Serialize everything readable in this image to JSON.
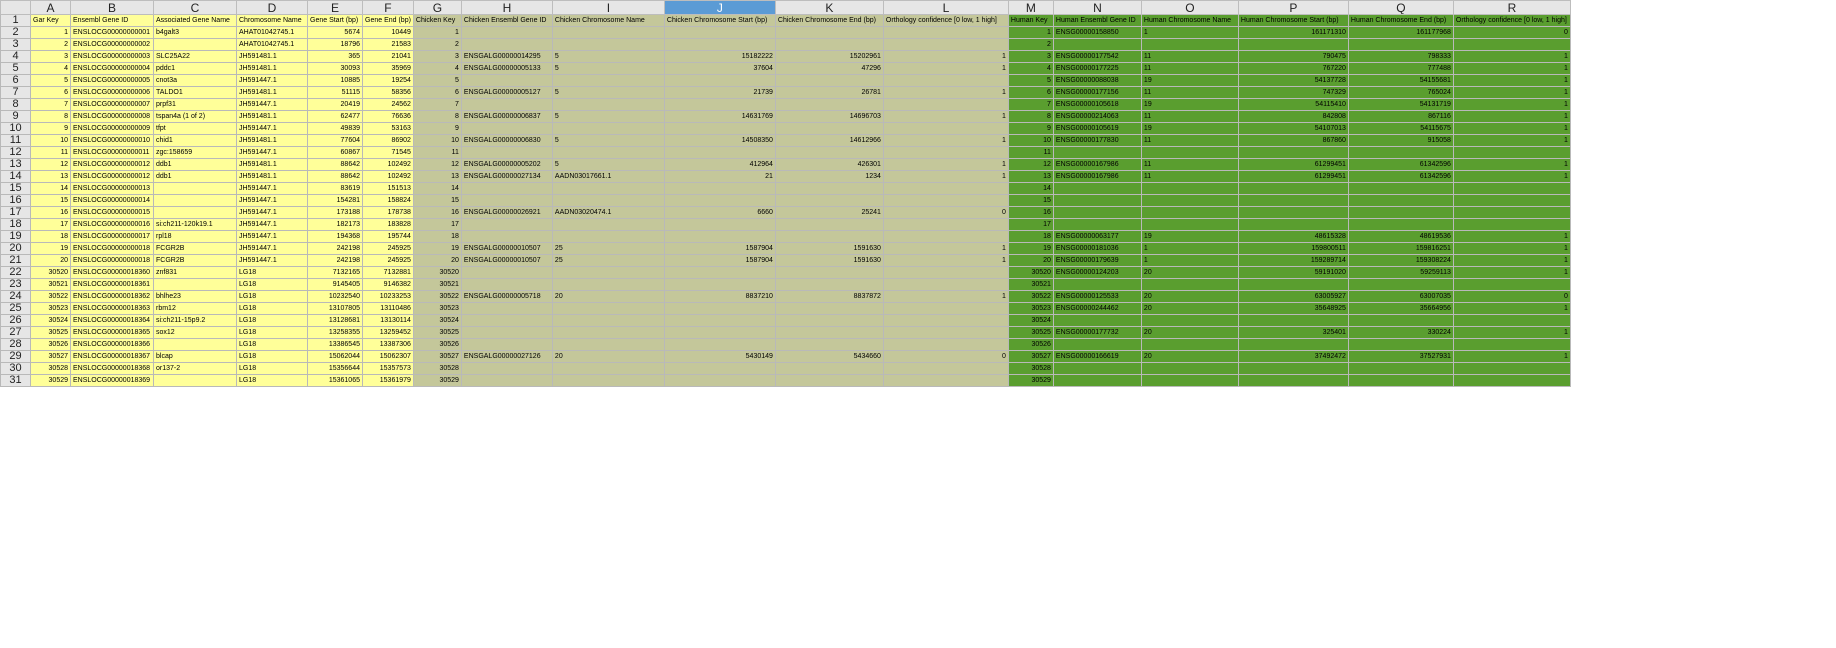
{
  "columns": [
    "A",
    "B",
    "C",
    "D",
    "E",
    "F",
    "G",
    "H",
    "I",
    "J",
    "K",
    "L",
    "M",
    "N",
    "O",
    "P",
    "Q",
    "R"
  ],
  "selected_column": "J",
  "colors": {
    "fish": "#ffff99",
    "chicken": "#c4c79a",
    "human": "#5a9e2f",
    "selection": "#5b9bd5"
  },
  "rows": [
    [
      "Gar Key",
      "Ensembl Gene ID",
      "Associated Gene Name",
      "Chromosome Name",
      "Gene Start (bp)",
      "Gene End (bp)",
      "Chicken Key",
      "Chicken Ensembl Gene ID",
      "Chicken Chromosome Name",
      "Chicken Chromosome Start (bp)",
      "Chicken Chromosome End (bp)",
      "Orthology confidence [0 low, 1 high]",
      "Human Key",
      "Human Ensembl Gene ID",
      "Human Chromosome Name",
      "Human Chromosome Start (bp)",
      "Human Chromosome End (bp)",
      "Orthology confidence [0 low, 1 high]"
    ],
    [
      "1",
      "ENSLOCG00000000001",
      "b4galt3",
      "AHAT01042745.1",
      "5674",
      "10449",
      "1",
      "",
      "",
      "",
      "",
      "",
      "1",
      "ENSG00000158850",
      "1",
      "161171310",
      "161177968",
      "0"
    ],
    [
      "2",
      "ENSLOCG00000000002",
      "",
      "AHAT01042745.1",
      "18796",
      "21583",
      "2",
      "",
      "",
      "",
      "",
      "",
      "2",
      "",
      "",
      "",
      "",
      ""
    ],
    [
      "3",
      "ENSLOCG00000000003",
      "SLC25A22",
      "JH591481.1",
      "365",
      "21041",
      "3",
      "ENSGALG00000014295",
      "5",
      "15182222",
      "15202961",
      "1",
      "3",
      "ENSG00000177542",
      "11",
      "790475",
      "798333",
      "1"
    ],
    [
      "4",
      "ENSLOCG00000000004",
      "pddc1",
      "JH591481.1",
      "30093",
      "35969",
      "4",
      "ENSGALG00000005133",
      "5",
      "37604",
      "47296",
      "1",
      "4",
      "ENSG00000177225",
      "11",
      "767220",
      "777488",
      "1"
    ],
    [
      "5",
      "ENSLOCG00000000005",
      "cnot3a",
      "JH591447.1",
      "10885",
      "19254",
      "5",
      "",
      "",
      "",
      "",
      "",
      "5",
      "ENSG00000088038",
      "19",
      "54137728",
      "54155681",
      "1"
    ],
    [
      "6",
      "ENSLOCG00000000006",
      "TALDO1",
      "JH591481.1",
      "51115",
      "58356",
      "6",
      "ENSGALG00000005127",
      "5",
      "21739",
      "26781",
      "1",
      "6",
      "ENSG00000177156",
      "11",
      "747329",
      "765024",
      "1"
    ],
    [
      "7",
      "ENSLOCG00000000007",
      "prpf31",
      "JH591447.1",
      "20419",
      "24562",
      "7",
      "",
      "",
      "",
      "",
      "",
      "7",
      "ENSG00000105618",
      "19",
      "54115410",
      "54131719",
      "1"
    ],
    [
      "8",
      "ENSLOCG00000000008",
      "tspan4a (1 of 2)",
      "JH591481.1",
      "62477",
      "76636",
      "8",
      "ENSGALG00000006837",
      "5",
      "14631769",
      "14696703",
      "1",
      "8",
      "ENSG00000214063",
      "11",
      "842808",
      "867116",
      "1"
    ],
    [
      "9",
      "ENSLOCG00000000009",
      "tfpt",
      "JH591447.1",
      "49839",
      "53163",
      "9",
      "",
      "",
      "",
      "",
      "",
      "9",
      "ENSG00000105619",
      "19",
      "54107013",
      "54115675",
      "1"
    ],
    [
      "10",
      "ENSLOCG00000000010",
      "chid1",
      "JH591481.1",
      "77604",
      "86902",
      "10",
      "ENSGALG00000006830",
      "5",
      "14508350",
      "14612966",
      "1",
      "10",
      "ENSG00000177830",
      "11",
      "867860",
      "915058",
      "1"
    ],
    [
      "11",
      "ENSLOCG00000000011",
      "zgc:158659",
      "JH591447.1",
      "60867",
      "71545",
      "11",
      "",
      "",
      "",
      "",
      "",
      "11",
      "",
      "",
      "",
      "",
      ""
    ],
    [
      "12",
      "ENSLOCG00000000012",
      "ddb1",
      "JH591481.1",
      "88642",
      "102492",
      "12",
      "ENSGALG00000005202",
      "5",
      "412964",
      "426301",
      "1",
      "12",
      "ENSG00000167986",
      "11",
      "61299451",
      "61342596",
      "1"
    ],
    [
      "13",
      "ENSLOCG00000000012",
      "ddb1",
      "JH591481.1",
      "88642",
      "102492",
      "13",
      "ENSGALG00000027134",
      "AADN03017661.1",
      "21",
      "1234",
      "1",
      "13",
      "ENSG00000167986",
      "11",
      "61299451",
      "61342596",
      "1"
    ],
    [
      "14",
      "ENSLOCG00000000013",
      "",
      "JH591447.1",
      "83619",
      "151513",
      "14",
      "",
      "",
      "",
      "",
      "",
      "14",
      "",
      "",
      "",
      "",
      ""
    ],
    [
      "15",
      "ENSLOCG00000000014",
      "",
      "JH591447.1",
      "154281",
      "158824",
      "15",
      "",
      "",
      "",
      "",
      "",
      "15",
      "",
      "",
      "",
      "",
      ""
    ],
    [
      "16",
      "ENSLOCG00000000015",
      "",
      "JH591447.1",
      "173188",
      "178738",
      "16",
      "ENSGALG00000026921",
      "AADN03020474.1",
      "6660",
      "25241",
      "0",
      "16",
      "",
      "",
      "",
      "",
      ""
    ],
    [
      "17",
      "ENSLOCG00000000016",
      "si:ch211-120k19.1",
      "JH591447.1",
      "182173",
      "183828",
      "17",
      "",
      "",
      "",
      "",
      "",
      "17",
      "",
      "",
      "",
      "",
      ""
    ],
    [
      "18",
      "ENSLOCG00000000017",
      "rpl18",
      "JH591447.1",
      "194368",
      "195744",
      "18",
      "",
      "",
      "",
      "",
      "",
      "18",
      "ENSG00000063177",
      "19",
      "48615328",
      "48619536",
      "1"
    ],
    [
      "19",
      "ENSLOCG00000000018",
      "FCGR2B",
      "JH591447.1",
      "242198",
      "245925",
      "19",
      "ENSGALG00000010507",
      "25",
      "1587904",
      "1591630",
      "1",
      "19",
      "ENSG00000181036",
      "1",
      "159800511",
      "159816251",
      "1"
    ],
    [
      "20",
      "ENSLOCG00000000018",
      "FCGR2B",
      "JH591447.1",
      "242198",
      "245925",
      "20",
      "ENSGALG00000010507",
      "25",
      "1587904",
      "1591630",
      "1",
      "20",
      "ENSG00000179639",
      "1",
      "159289714",
      "159308224",
      "1"
    ],
    [
      "30520",
      "ENSLOCG00000018360",
      "znf831",
      "LG18",
      "7132165",
      "7132881",
      "30520",
      "",
      "",
      "",
      "",
      "",
      "30520",
      "ENSG00000124203",
      "20",
      "59191020",
      "59259113",
      "1"
    ],
    [
      "30521",
      "ENSLOCG00000018361",
      "",
      "LG18",
      "9145405",
      "9146382",
      "30521",
      "",
      "",
      "",
      "",
      "",
      "30521",
      "",
      "",
      "",
      "",
      ""
    ],
    [
      "30522",
      "ENSLOCG00000018362",
      "bhlhe23",
      "LG18",
      "10232540",
      "10233253",
      "30522",
      "ENSGALG00000005718",
      "20",
      "8837210",
      "8837872",
      "1",
      "30522",
      "ENSG00000125533",
      "20",
      "63005927",
      "63007035",
      "0"
    ],
    [
      "30523",
      "ENSLOCG00000018363",
      "rbm12",
      "LG18",
      "13107805",
      "13110486",
      "30523",
      "",
      "",
      "",
      "",
      "",
      "30523",
      "ENSG00000244462",
      "20",
      "35648925",
      "35664956",
      "1"
    ],
    [
      "30524",
      "ENSLOCG00000018364",
      "si:ch211-15p9.2",
      "LG18",
      "13128681",
      "13130114",
      "30524",
      "",
      "",
      "",
      "",
      "",
      "30524",
      "",
      "",
      "",
      "",
      ""
    ],
    [
      "30525",
      "ENSLOCG00000018365",
      "sox12",
      "LG18",
      "13258355",
      "13259452",
      "30525",
      "",
      "",
      "",
      "",
      "",
      "30525",
      "ENSG00000177732",
      "20",
      "325401",
      "330224",
      "1"
    ],
    [
      "30526",
      "ENSLOCG00000018366",
      "",
      "LG18",
      "13386545",
      "13387306",
      "30526",
      "",
      "",
      "",
      "",
      "",
      "30526",
      "",
      "",
      "",
      "",
      ""
    ],
    [
      "30527",
      "ENSLOCG00000018367",
      "blcap",
      "LG18",
      "15062044",
      "15062307",
      "30527",
      "ENSGALG00000027126",
      "20",
      "5430149",
      "5434660",
      "0",
      "30527",
      "ENSG00000166619",
      "20",
      "37492472",
      "37527931",
      "1"
    ],
    [
      "30528",
      "ENSLOCG00000018368",
      "or137-2",
      "LG18",
      "15356644",
      "15357573",
      "30528",
      "",
      "",
      "",
      "",
      "",
      "30528",
      "",
      "",
      "",
      "",
      ""
    ],
    [
      "30529",
      "ENSLOCG00000018369",
      "",
      "LG18",
      "15361065",
      "15361979",
      "30529",
      "",
      "",
      "",
      "",
      "",
      "30529",
      "",
      "",
      "",
      "",
      ""
    ]
  ]
}
